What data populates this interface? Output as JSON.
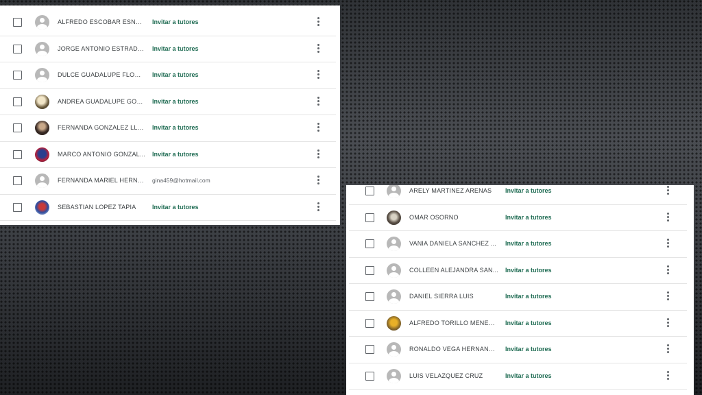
{
  "invite_label": "Invitar a tutores",
  "colors": {
    "invite_link": "#1e6b52",
    "text": "#3c4043",
    "divider": "#e4e4e4"
  },
  "icons": {
    "checkbox": "checkbox-icon",
    "avatar_default": "default-avatar-icon",
    "more": "more-vert-icon"
  },
  "left_panel": {
    "rows": [
      {
        "name": "ALFREDO ESCOBAR ESNAU...",
        "contact": "Invitar a tutores",
        "avatar": "default"
      },
      {
        "name": "JORGE ANTONIO ESTRADA ...",
        "contact": "Invitar a tutores",
        "avatar": "default"
      },
      {
        "name": "DULCE GUADALUPE FLORE...",
        "contact": "Invitar a tutores",
        "avatar": "default"
      },
      {
        "name": "ANDREA GUADALUPE GOM...",
        "contact": "Invitar a tutores",
        "avatar": "photo-1"
      },
      {
        "name": "FERNANDA GONZALEZ LLE...",
        "contact": "Invitar a tutores",
        "avatar": "photo-2"
      },
      {
        "name": "MARCO ANTONIO GONZAL...",
        "contact": "Invitar a tutores",
        "avatar": "photo-3"
      },
      {
        "name": "FERNANDA MARIEL HERNA...",
        "contact": "gina459@hotmail.com",
        "avatar": "default"
      },
      {
        "name": "SEBASTIAN LOPEZ TAPIA",
        "contact": "Invitar a tutores",
        "avatar": "photo-4"
      }
    ]
  },
  "right_panel": {
    "rows": [
      {
        "name": "ARELY MARTINEZ ARENAS",
        "contact": "Invitar a tutores",
        "avatar": "default"
      },
      {
        "name": "OMAR OSORNO",
        "contact": "Invitar a tutores",
        "avatar": "photo-5"
      },
      {
        "name": "VANIA DANIELA SANCHEZ ...",
        "contact": "Invitar a tutores",
        "avatar": "default"
      },
      {
        "name": "COLLEEN ALEJANDRA SAN...",
        "contact": "Invitar a tutores",
        "avatar": "default"
      },
      {
        "name": "DANIEL SIERRA LUIS",
        "contact": "Invitar a tutores",
        "avatar": "default"
      },
      {
        "name": "ALFREDO TORILLO MENESES",
        "contact": "Invitar a tutores",
        "avatar": "photo-6"
      },
      {
        "name": "RONALDO VEGA HERNAND...",
        "contact": "Invitar a tutores",
        "avatar": "default"
      },
      {
        "name": "LUIS VELAZQUEZ CRUZ",
        "contact": "Invitar a tutores",
        "avatar": "default"
      }
    ]
  }
}
